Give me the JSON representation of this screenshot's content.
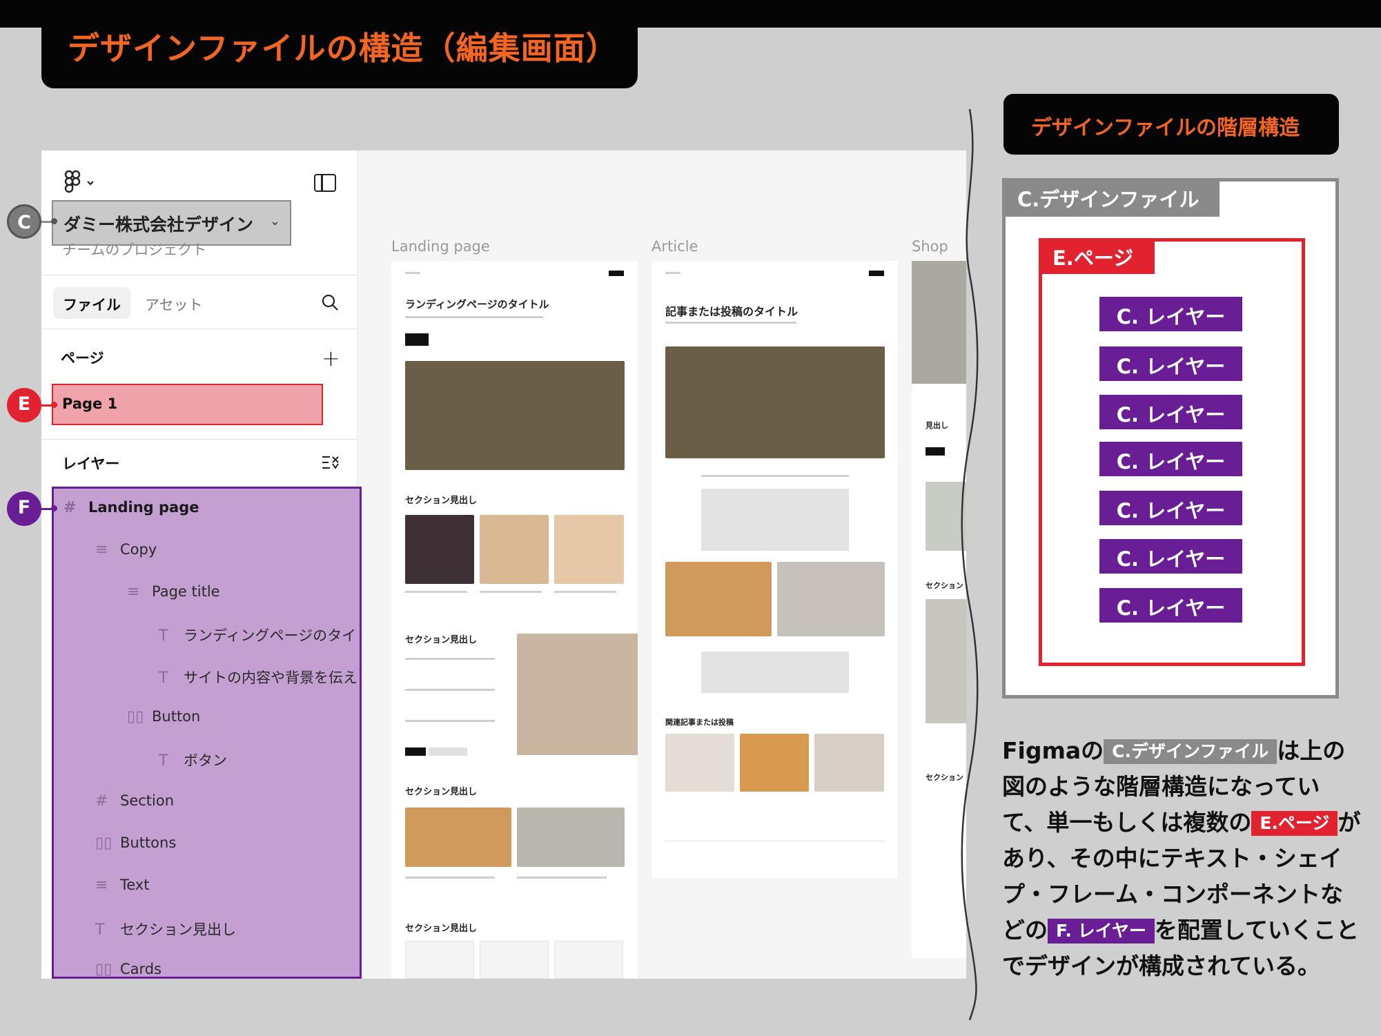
{
  "header": {
    "title": "デザインファイルの構造（編集画面）"
  },
  "sidebar": {
    "project_name": "ダミー株式会社デザイン",
    "team_name": "チームのプロジェクト",
    "tabs": {
      "file": "ファイル",
      "assets": "アセット"
    },
    "pages_label": "ページ",
    "page_item": "Page 1",
    "layers_label": "レイヤー",
    "layers": [
      {
        "icon": "#",
        "label": "Landing page"
      },
      {
        "icon": "≡",
        "label": "Copy"
      },
      {
        "icon": "≡",
        "label": "Page title"
      },
      {
        "icon": "T",
        "label": "ランディングページのタイ"
      },
      {
        "icon": "T",
        "label": "サイトの内容や背景を伝え"
      },
      {
        "icon": "▯▯",
        "label": "Button"
      },
      {
        "icon": "T",
        "label": "ボタン"
      },
      {
        "icon": "#",
        "label": "Section"
      },
      {
        "icon": "▯▯",
        "label": "Buttons"
      },
      {
        "icon": "≡",
        "label": "Text"
      },
      {
        "icon": "T",
        "label": "セクション見出し"
      },
      {
        "icon": "▯▯",
        "label": "Cards"
      }
    ]
  },
  "markers": {
    "c": "C",
    "e": "E",
    "f": "F"
  },
  "canvas": {
    "frames": [
      "Landing page",
      "Article",
      "Shop"
    ],
    "landing": {
      "title": "ランディングページのタイトル",
      "section1": "セクション見出し",
      "section2": "セクション見出し",
      "section3": "セクション見出し",
      "section4": "セクション見出し"
    },
    "article": {
      "title": "記事または投稿のタイトル",
      "related": "関連記事または投稿"
    },
    "shop": {
      "heading": "見出し",
      "section": "セクション"
    }
  },
  "hierarchy": {
    "title": "デザインファイルの階層構造",
    "file_label": "C.デザインファイル",
    "page_label": "E.ページ",
    "layers": [
      "C. レイヤー",
      "C. レイヤー",
      "C. レイヤー",
      "C. レイヤー",
      "C. レイヤー",
      "C. レイヤー",
      "C. レイヤー"
    ]
  },
  "description": {
    "p1": "Figmaの",
    "tag1": "C.デザインファイル",
    "p2": "は上の図のような階層構造になっていて、単一もしくは複数の",
    "tag2": "E.ページ",
    "p3": "があり、その中にテキスト・シェイプ・フレーム・コンポーネントなどの",
    "tag3": "F. レイヤー",
    "p4": "を配置していくことでデザインが構成されている。"
  },
  "colors": {
    "accent_orange": "#f26522",
    "page_red": "#e32230",
    "layer_purple": "#6a1e96",
    "file_gray": "#8a8a8a"
  }
}
